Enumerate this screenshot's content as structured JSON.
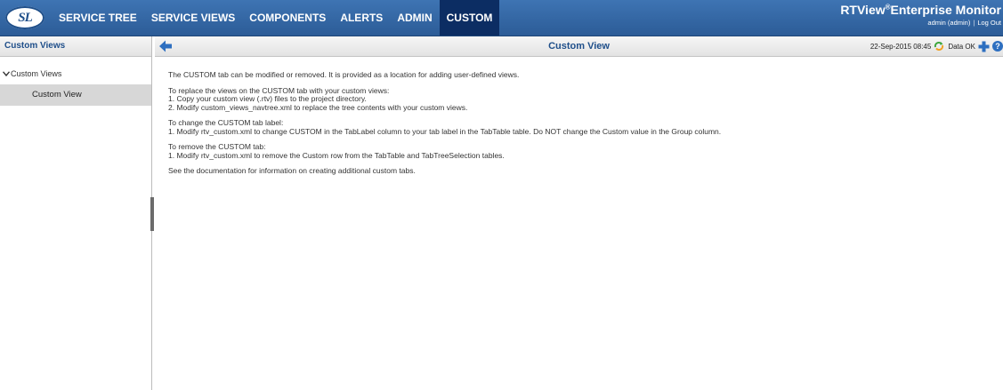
{
  "header": {
    "logo_text": "SL",
    "tabs": [
      {
        "label": "SERVICE TREE"
      },
      {
        "label": "SERVICE VIEWS"
      },
      {
        "label": "COMPONENTS"
      },
      {
        "label": "ALERTS"
      },
      {
        "label": "ADMIN"
      },
      {
        "label": "CUSTOM",
        "active": true
      }
    ],
    "brand": {
      "name_prefix": "RTView",
      "registered": "®",
      "name_suffix": "Enterprise Monitor",
      "user": "admin (admin)",
      "logout": "Log Out"
    }
  },
  "sidebar": {
    "title": "Custom Views",
    "tree": {
      "group_label": "Custom Views",
      "items": [
        {
          "label": "Custom View",
          "selected": true
        }
      ]
    }
  },
  "main": {
    "title": "Custom View",
    "status": {
      "timestamp": "22-Sep-2015 08:45",
      "data_status": "Data OK",
      "help_symbol": "?"
    },
    "paragraphs": [
      {
        "lines": [
          "The CUSTOM tab can be modified or removed. It is provided as a location for adding user-defined views."
        ]
      },
      {
        "lines": [
          "To replace the views on the CUSTOM tab with your custom views:",
          "1. Copy your custom view (.rtv) files to the project directory.",
          "2. Modify custom_views_navtree.xml to replace the tree contents with your custom views."
        ]
      },
      {
        "lines": [
          "To change the CUSTOM tab label:",
          "1. Modify rtv_custom.xml to change CUSTOM in the TabLabel column to your tab label in the TabTable table. Do NOT change the Custom value in the Group column."
        ]
      },
      {
        "lines": [
          "To remove the CUSTOM tab:",
          "1. Modify rtv_custom.xml to remove the Custom row from the TabTable and TabTreeSelection tables."
        ]
      },
      {
        "lines": [
          "See the documentation for information on creating additional custom tabs."
        ]
      }
    ]
  },
  "colors": {
    "nav_bar": "#2f63a1",
    "nav_active": "#0c2d63",
    "title_text": "#1f4f8a",
    "status_ok": "#3aa53a"
  }
}
